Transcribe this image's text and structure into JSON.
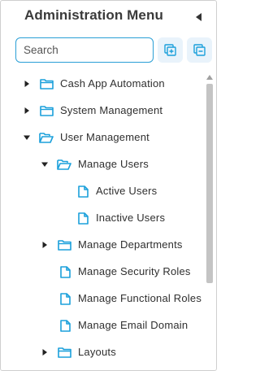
{
  "header": {
    "title": "Administration Menu",
    "collapse_icon": "caret-left-icon"
  },
  "search": {
    "placeholder": "Search",
    "value": ""
  },
  "toolbar": {
    "expand_all_icon": "expand-all-icon",
    "collapse_all_icon": "collapse-all-icon"
  },
  "colors": {
    "accent": "#2a9fd6",
    "icon": "#1ba0db",
    "button_bg": "#e9f3fb",
    "text": "#2f2f2f"
  },
  "tree": {
    "items": [
      {
        "label": "Cash App Automation",
        "level": 0,
        "state": "collapsed",
        "type": "folder"
      },
      {
        "label": "System Management",
        "level": 0,
        "state": "collapsed",
        "type": "folder"
      },
      {
        "label": "User Management",
        "level": 0,
        "state": "expanded",
        "type": "folder"
      },
      {
        "label": "Manage Users",
        "level": 1,
        "state": "expanded",
        "type": "folder"
      },
      {
        "label": "Active Users",
        "level": 2,
        "state": "leaf",
        "type": "page"
      },
      {
        "label": "Inactive Users",
        "level": 2,
        "state": "leaf",
        "type": "page"
      },
      {
        "label": "Manage Departments",
        "level": 1,
        "state": "collapsed",
        "type": "folder"
      },
      {
        "label": "Manage Security Roles",
        "level": 1,
        "state": "leaf",
        "type": "page"
      },
      {
        "label": "Manage Functional Roles",
        "level": 1,
        "state": "leaf",
        "type": "page"
      },
      {
        "label": "Manage Email Domain",
        "level": 1,
        "state": "leaf",
        "type": "page"
      },
      {
        "label": "Layouts",
        "level": 1,
        "state": "collapsed",
        "type": "folder"
      }
    ]
  }
}
